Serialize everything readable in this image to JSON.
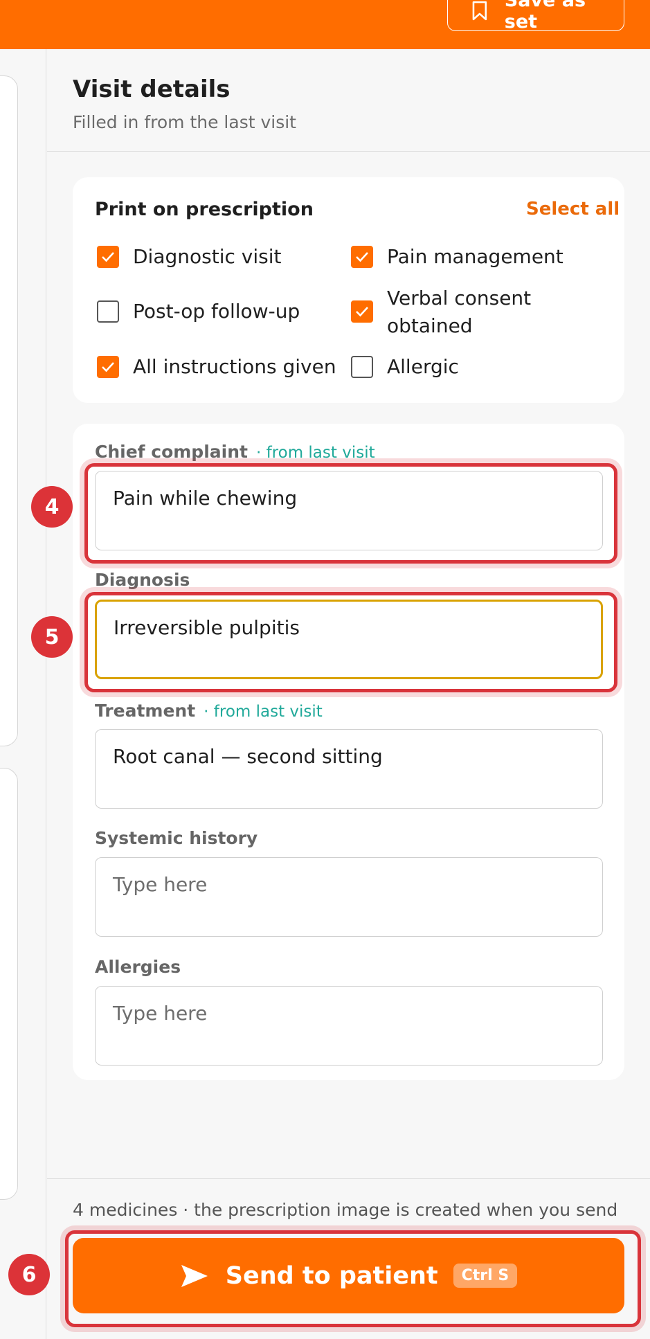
{
  "toolbar": {
    "save_set_label": "Save as set",
    "bookmark_icon": "bookmark-icon"
  },
  "visit": {
    "title": "Visit details",
    "subtitle": "Filled in from the last visit"
  },
  "print": {
    "title": "Print on prescription",
    "select_all": "Select all",
    "options": [
      {
        "label": "Diagnostic visit",
        "checked": true
      },
      {
        "label": "Pain management",
        "checked": true
      },
      {
        "label": "Post-op follow-up",
        "checked": false
      },
      {
        "label": "Verbal consent obtained",
        "checked": true
      },
      {
        "label": "All instructions given",
        "checked": true
      },
      {
        "label": "Allergic",
        "checked": false
      }
    ]
  },
  "fields": {
    "chief_complaint": {
      "label": "Chief complaint",
      "tag": "· from last visit",
      "value": "Pain while chewing"
    },
    "diagnosis": {
      "label": "Diagnosis",
      "value": "Irreversible pulpitis"
    },
    "treatment": {
      "label": "Treatment",
      "tag": "· from last visit",
      "value": "Root canal — second sitting"
    },
    "systemic_history": {
      "label": "Systemic history",
      "placeholder": "Type here"
    },
    "allergies": {
      "label": "Allergies",
      "placeholder": "Type here"
    }
  },
  "annotations": {
    "badge4": "4",
    "badge5": "5",
    "badge6": "6"
  },
  "footer": {
    "note": "4 medicines · the prescription image is created when you send",
    "send_label": "Send to patient",
    "shortcut": "Ctrl S"
  },
  "colors": {
    "accent": "#ff6d00",
    "highlight": "#d9343b",
    "teal": "#21a99a",
    "focus_border": "#d9a200"
  }
}
